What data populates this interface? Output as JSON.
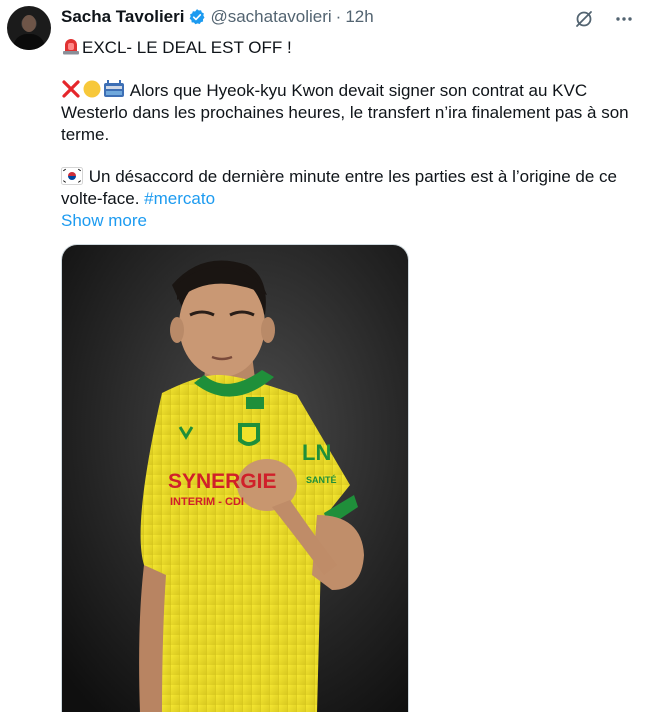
{
  "author": {
    "name": "Sacha Tavolieri",
    "handle": "@sachatavolieri",
    "separator": "·",
    "time": "12h"
  },
  "post": {
    "headline": "EXCL- LE DEAL EST OFF !",
    "paragraph_2": "Alors que Hyeok-kyu Kwon devait signer son contrat au KVC Westerlo dans les prochaines heures, le transfert n’ira finalement pas à son terme.",
    "paragraph_3": "Un désaccord de dernière minute entre les parties est à l’origine de ce volte-face.",
    "hashtag": "#mercato",
    "show_more": "Show more"
  },
  "media": {
    "jersey_sponsor_line1": "SYNERGIE",
    "jersey_sponsor_line2": "INTERIM - CDI",
    "sleeve_text": "SANTÉ",
    "sleeve_logo": "LN"
  },
  "icons": {
    "headline_emoji": "rotating-light-icon",
    "para2_emojis": [
      "cross-mark-icon",
      "yellow-circle-icon",
      "stadium-icon"
    ],
    "para3_emoji": "south-korea-flag-icon",
    "verified": "verified-badge-icon",
    "grok": "grok-icon",
    "more": "more-options-icon"
  },
  "colors": {
    "link": "#1d9bf0",
    "secondary_text": "#536471",
    "jersey_yellow": "#f2e22a",
    "jersey_green": "#1f8f3a",
    "sponsor_red": "#d0202a"
  }
}
